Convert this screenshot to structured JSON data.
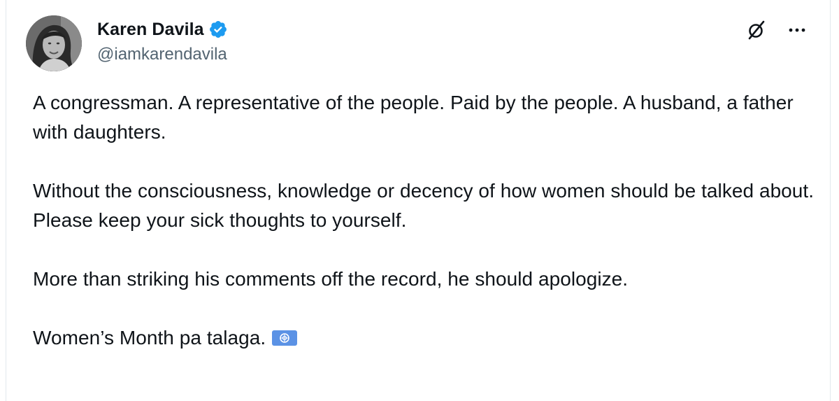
{
  "author": {
    "display_name": "Karen Davila",
    "handle": "@iamkarendavila",
    "verified": true,
    "avatar_icon": "profile-photo",
    "verified_icon": "verified-badge-icon"
  },
  "actions": {
    "grok_icon": "grok-icon",
    "more_icon": "more-options-icon"
  },
  "tweet": {
    "paragraphs": [
      "A congressman. A representative of the people. Paid by the people. A husband, a father with daughters.",
      "Without the consciousness, knowledge or decency of how women should be talked about.  Please keep your sick thoughts to yourself.",
      "More than striking his comments off the record, he should apologize.",
      "Women’s Month pa talaga."
    ],
    "emoji": "united-nations-flag"
  },
  "colors": {
    "text": "#0f1419",
    "secondary": "#536471",
    "verified": "#1d9bf0",
    "border": "#e1e8ed"
  }
}
